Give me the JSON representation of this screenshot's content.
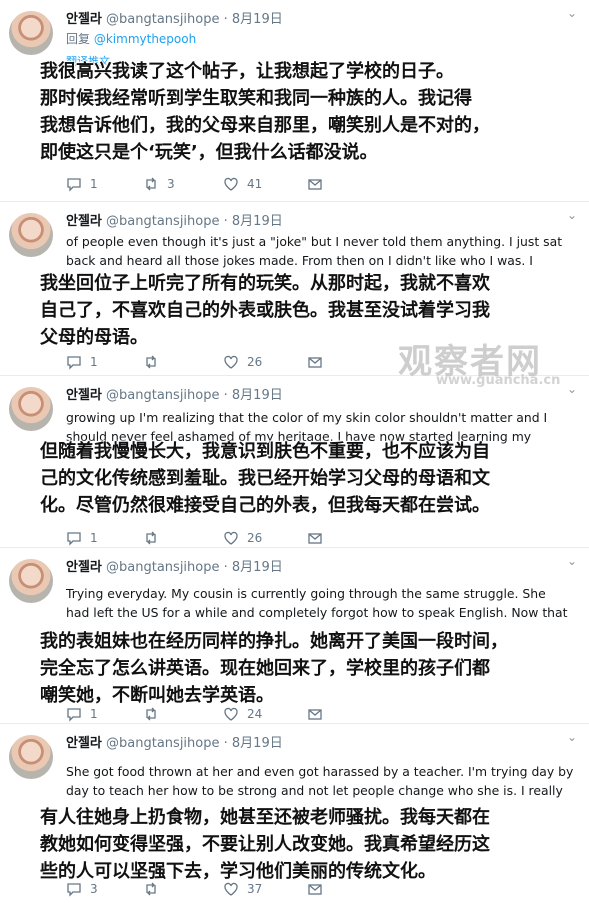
{
  "tweets": [
    {
      "name": "안젤라",
      "handle": "@bangtansjihope",
      "time": "8月19日",
      "reply_prefix": "回复",
      "reply_to": "@kimmythepooh",
      "english_lines": [
        "",
        "",
        "",
        "",
        "翻译推文"
      ],
      "chinese_lines": [
        "我很高兴我读了这个帖子，让我想起了学校的日子。",
        "那时候我经常听到学生取笑和我同一种族的人。我记得",
        "我想告诉他们，我的父母来自那里，嘲笑别人是不对的，",
        "即使这只是个‘玩笑’，但我什么话都没说。"
      ],
      "replies": "1",
      "retweets": "3",
      "likes": "41"
    },
    {
      "name": "안젤라",
      "handle": "@bangtansjihope",
      "time": "8月19日",
      "english_lines": [
        "of people even though it's just a \"joke\" but I never told them anything. I just sat",
        "back and heard all those jokes made. From then on I didn't like who I was. I"
      ],
      "chinese_lines": [
        "我坐回位子上听完了所有的玩笑。从那时起，我就不喜欢",
        "自己了，不喜欢自己的外表或肤色。我甚至没试着学习我",
        "父母的母语。"
      ],
      "replies": "1",
      "retweets": "",
      "likes": "26"
    },
    {
      "name": "안젤라",
      "handle": "@bangtansjihope",
      "time": "8月19日",
      "english_lines": [
        "growing up I'm realizing that the color of my skin color shouldn't matter and I",
        "should never feel ashamed of my heritage. I have now started learning my"
      ],
      "chinese_lines": [
        "但随着我慢慢长大，我意识到肤色不重要，也不应该为自",
        "己的文化传统感到羞耻。我已经开始学习父母的母语和文",
        "化。尽管仍然很难接受自己的外表，但我每天都在尝试。"
      ],
      "replies": "1",
      "retweets": "",
      "likes": "26"
    },
    {
      "name": "안젤라",
      "handle": "@bangtansjihope",
      "time": "8月19日",
      "english_lines": [
        "Trying everyday. My cousin is currently going through the same struggle. She",
        "had left the US for a while and completely forgot how to speak English. Now that"
      ],
      "chinese_lines": [
        "我的表姐妹也在经历同样的挣扎。她离开了美国一段时间，",
        "完全忘了怎么讲英语。现在她回来了，学校里的孩子们都",
        "嘲笑她，不断叫她去学英语。"
      ],
      "replies": "1",
      "retweets": "",
      "likes": "24"
    },
    {
      "name": "안젤라",
      "handle": "@bangtansjihope",
      "time": "8月19日",
      "english_lines": [
        "She got food thrown at her and even got harassed by a teacher. I'm trying day by",
        "day to teach her how to be strong and not let people change who she is. I really"
      ],
      "chinese_lines": [
        "有人往她身上扔食物，她甚至还被老师骚扰。我每天都在",
        "教她如何变得坚强，不要让别人改变她。我真希望经历这",
        "些的人可以坚强下去，学习他们美丽的传统文化。"
      ],
      "replies": "3",
      "retweets": "",
      "likes": "37"
    }
  ],
  "watermark": {
    "text": "观察者网",
    "url": "www.guancha.cn"
  },
  "icons": {
    "reply": "reply-icon",
    "retweet": "retweet-icon",
    "like": "heart-icon",
    "message": "mail-icon",
    "more": "chevron-down-icon"
  },
  "colors": {
    "link": "#1da1f2",
    "muted": "#657786",
    "divider": "#e6ecf0"
  }
}
